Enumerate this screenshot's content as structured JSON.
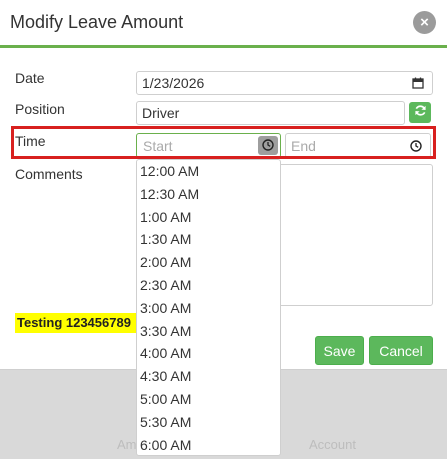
{
  "backdrop": {
    "left_text": "Am",
    "right_text": "Account"
  },
  "modal": {
    "title": "Modify Leave Amount",
    "close_glyph": "×",
    "fields": {
      "date": {
        "label": "Date",
        "value": "1/23/2026"
      },
      "position": {
        "label": "Position",
        "value": "Driver"
      },
      "time": {
        "label": "Time",
        "start_placeholder": "Start",
        "end_placeholder": "End"
      },
      "comments": {
        "label": "Comments",
        "value": ""
      }
    },
    "badge_text": "Testing 123456789",
    "buttons": {
      "save": "Save",
      "cancel": "Cancel"
    }
  },
  "time_dropdown": {
    "options": [
      "12:00 AM",
      "12:30 AM",
      "1:00 AM",
      "1:30 AM",
      "2:00 AM",
      "2:30 AM",
      "3:00 AM",
      "3:30 AM",
      "4:00 AM",
      "4:30 AM",
      "5:00 AM",
      "5:30 AM",
      "6:00 AM"
    ]
  },
  "colors": {
    "accent": "#6ab04c",
    "button": "#5cb85c",
    "highlight": "#d8201f",
    "badge": "#ffff00"
  },
  "icons": {
    "close": "close-icon",
    "calendar": "calendar-icon",
    "refresh": "refresh-icon",
    "clock": "clock-icon"
  }
}
